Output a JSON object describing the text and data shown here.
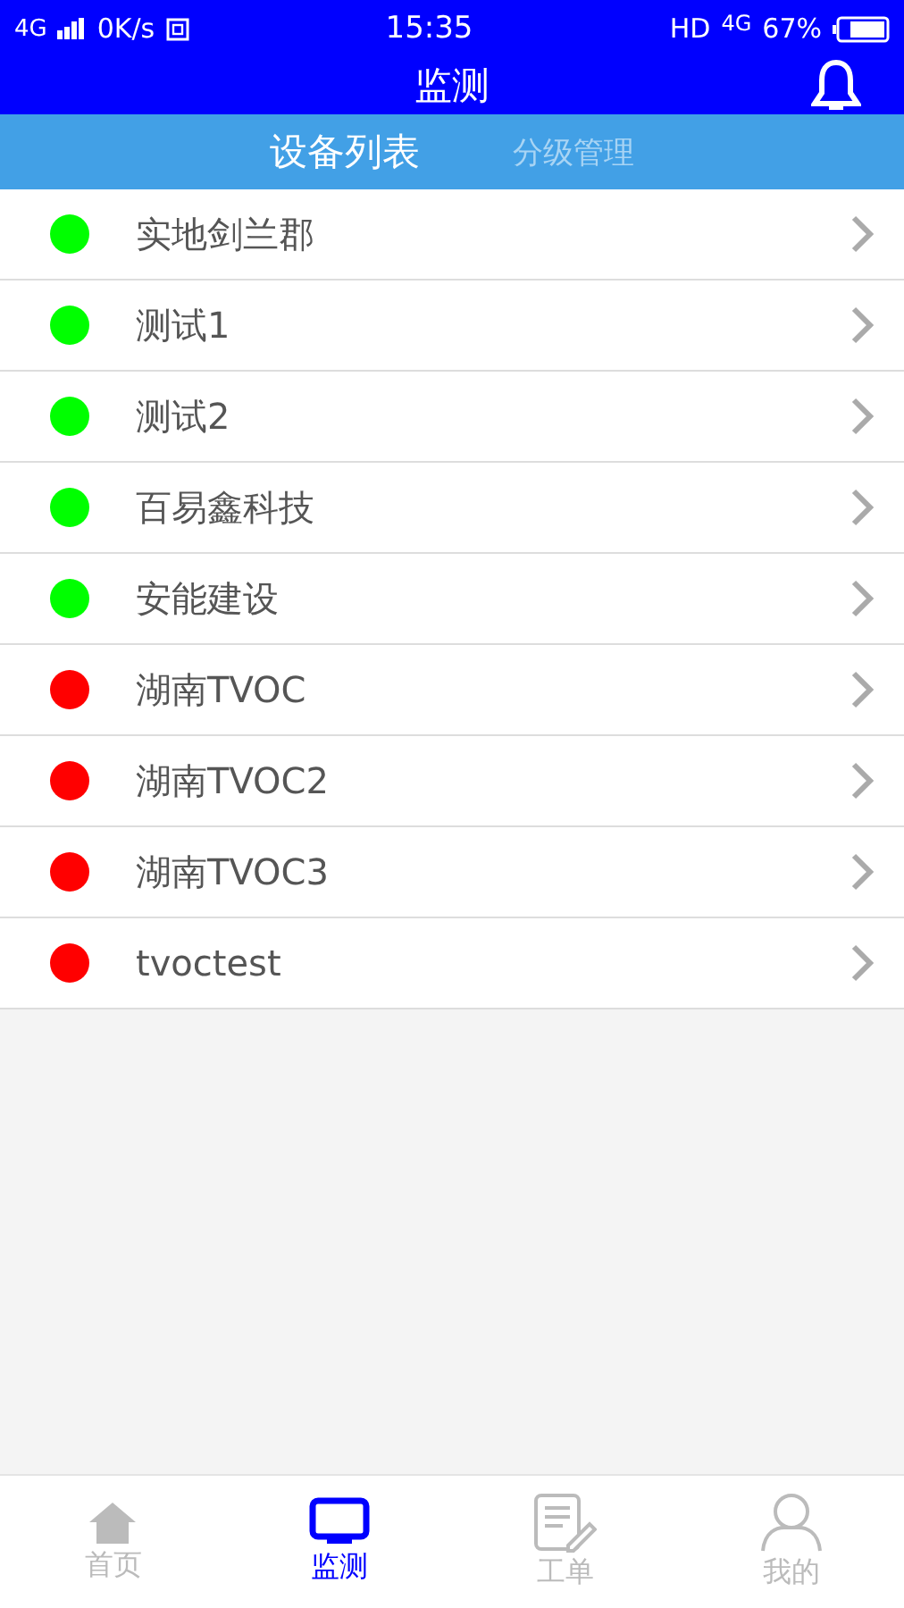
{
  "status_bar": {
    "network": "4G",
    "speed": "0K/s",
    "time": "15:35",
    "right_network": "HD",
    "right_network_2": "4G",
    "battery": "67%"
  },
  "header": {
    "title": "监测"
  },
  "tabs": [
    {
      "label": "设备列表",
      "selected": true
    },
    {
      "label": "分级管理",
      "selected": false
    }
  ],
  "devices": [
    {
      "name": "实地剑兰郡",
      "color": "#00ff00"
    },
    {
      "name": "测试1",
      "color": "#00ff00"
    },
    {
      "name": "测试2",
      "color": "#00ff00"
    },
    {
      "name": "百易鑫科技",
      "color": "#00ff00"
    },
    {
      "name": "安能建设",
      "color": "#00ff00"
    },
    {
      "name": "湖南TVOC",
      "color": "#ff0000"
    },
    {
      "name": "湖南TVOC2",
      "color": "#ff0000"
    },
    {
      "name": "湖南TVOC3",
      "color": "#ff0000"
    },
    {
      "name": "tvoctest",
      "color": "#ff0000"
    }
  ],
  "bottom_nav": [
    {
      "label": "首页",
      "kind": "home",
      "selected": false
    },
    {
      "label": "监测",
      "kind": "monitor",
      "selected": true
    },
    {
      "label": "工单",
      "kind": "document",
      "selected": false
    },
    {
      "label": "我的",
      "kind": "person",
      "selected": false
    }
  ]
}
